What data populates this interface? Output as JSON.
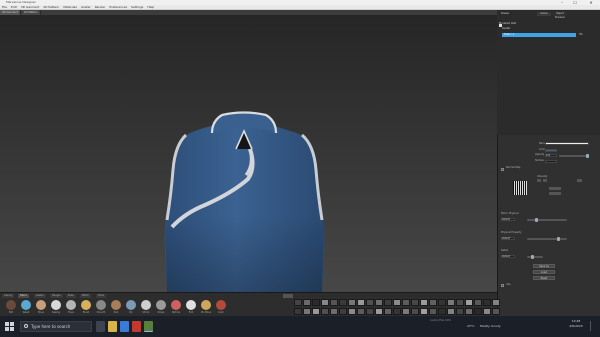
{
  "window": {
    "title": "Marvelous Designer",
    "controls": [
      "–",
      "☐",
      "✕"
    ]
  },
  "menu": [
    "File",
    "Edit",
    "3D Garment",
    "2D Pattern",
    "Materials",
    "Avatar",
    "Render",
    "Preferences",
    "Settings",
    "Help"
  ],
  "doc_tabs": [
    "3D Garment",
    "2D Pattern"
  ],
  "scene_panel": {
    "tabs": [
      "Scene",
      "Object Browser"
    ],
    "header": "Scene",
    "rows": [
      {
        "label": "Modelist Vest",
        "selected": false
      },
      {
        "label": "Avatar",
        "selected": false
      },
      {
        "label": "Fabric 1",
        "selected": true
      }
    ],
    "selected_value": "0%"
  },
  "property_panel": {
    "title": "Property Editor",
    "fields": [
      {
        "label": "Name"
      },
      {
        "label": "Color"
      },
      {
        "label": "Opacity",
        "value": "100"
      },
      {
        "label": "Texture"
      }
    ],
    "normal_map_label": "Normal Map",
    "normal_map_intensity_label": "Intensity",
    "sections": [
      {
        "title": "Fabric Physical",
        "field": "Default"
      },
      {
        "title": "Physical Property",
        "field": "Default"
      },
      {
        "title": "Detail",
        "field": "Default"
      }
    ],
    "buttons": [
      "Save As",
      "Load",
      "Reset"
    ],
    "checkbox_label": "Use"
  },
  "bottom_library": {
    "tabs": [
      "Library",
      "Fabric",
      "Avatar",
      "Hanger",
      "Pose",
      "Stitch",
      "Tools"
    ],
    "tool_labels": [
      "Edit",
      "Select",
      "Move",
      "Sewing",
      "Trace",
      "Brush",
      "Smooth",
      "Tuck",
      "Pin",
      "Shrink",
      "Drape",
      "Particle",
      "Fold",
      "Pin Move",
      "Color"
    ],
    "tool_colors": [
      "#6a4b3a",
      "#5ba8d0",
      "#c7a07a",
      "#d8d8d8",
      "#b5b5b5",
      "#d6b15a",
      "#888888",
      "#a77d5a",
      "#7a9ab5",
      "#cfcfcf",
      "#9b9b9b",
      "#d06060",
      "#e0e0e0",
      "#d2a55e",
      "#b34a3c"
    ]
  },
  "taskbar": {
    "search_placeholder": "Type here to search",
    "time": "10:48",
    "date": "4/8/2020",
    "status": "Mostly cloudy",
    "temperature": "23°C"
  },
  "status_line": "Loading Files 100%"
}
